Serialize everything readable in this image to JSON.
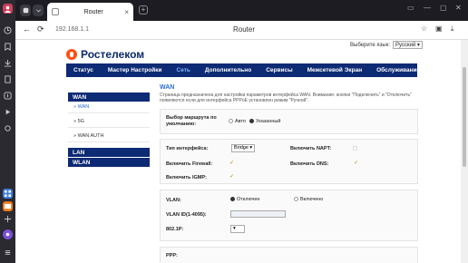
{
  "browser": {
    "tab_title": "Router",
    "tab_close": "×",
    "new_tab": "+",
    "url": "192.168.1.1",
    "page_title": "Router",
    "win_controls": [
      "▭",
      "—",
      "▢",
      "✕"
    ]
  },
  "header": {
    "brand": "Ростелеком",
    "lang_label": "Выберите язык:",
    "lang_value": "Русский"
  },
  "nav": [
    {
      "label": "Статус",
      "active": false
    },
    {
      "label": "Мастер Настройки",
      "active": false
    },
    {
      "label": "Сеть",
      "active": true
    },
    {
      "label": "Дополнительно",
      "active": false
    },
    {
      "label": "Сервисы",
      "active": false
    },
    {
      "label": "Межсетевой Экран",
      "active": false
    },
    {
      "label": "Обслуживание",
      "active": false
    }
  ],
  "sidebar": {
    "wan_header": "WAN",
    "items": [
      "WAN",
      "5G",
      "WAN AUTH"
    ],
    "lan_header": "LAN",
    "wlan_header": "WLAN"
  },
  "content": {
    "heading": "WAN",
    "description": "Страница предназначена для настройки параметров интерфейса WAN. Внимание: кнопки \"Подключить\" и \"Отключить\" появляются если для интерфейса PPPoE установлен режим \"Ручной\"."
  },
  "route": {
    "label": "Выбор маршрута по умолчанию:",
    "opt_auto": "Авто",
    "opt_specified": "Указанный"
  },
  "iface": {
    "type_label": "Тип интерфейса:",
    "type_value": "Bridge",
    "napt_label": "Включить NAPT:",
    "firewall_label": "Включить Firewall:",
    "dns_label": "Включить DNS:",
    "igmp_label": "Включить IGMP:",
    "check_glyph": "✓"
  },
  "vlan": {
    "label": "VLAN:",
    "opt_off": "Отключен",
    "opt_on": "Включено",
    "id_label": "VLAN ID(1-4095):",
    "p_label": "802.1P:"
  },
  "ppp": {
    "label": "PPP:"
  }
}
